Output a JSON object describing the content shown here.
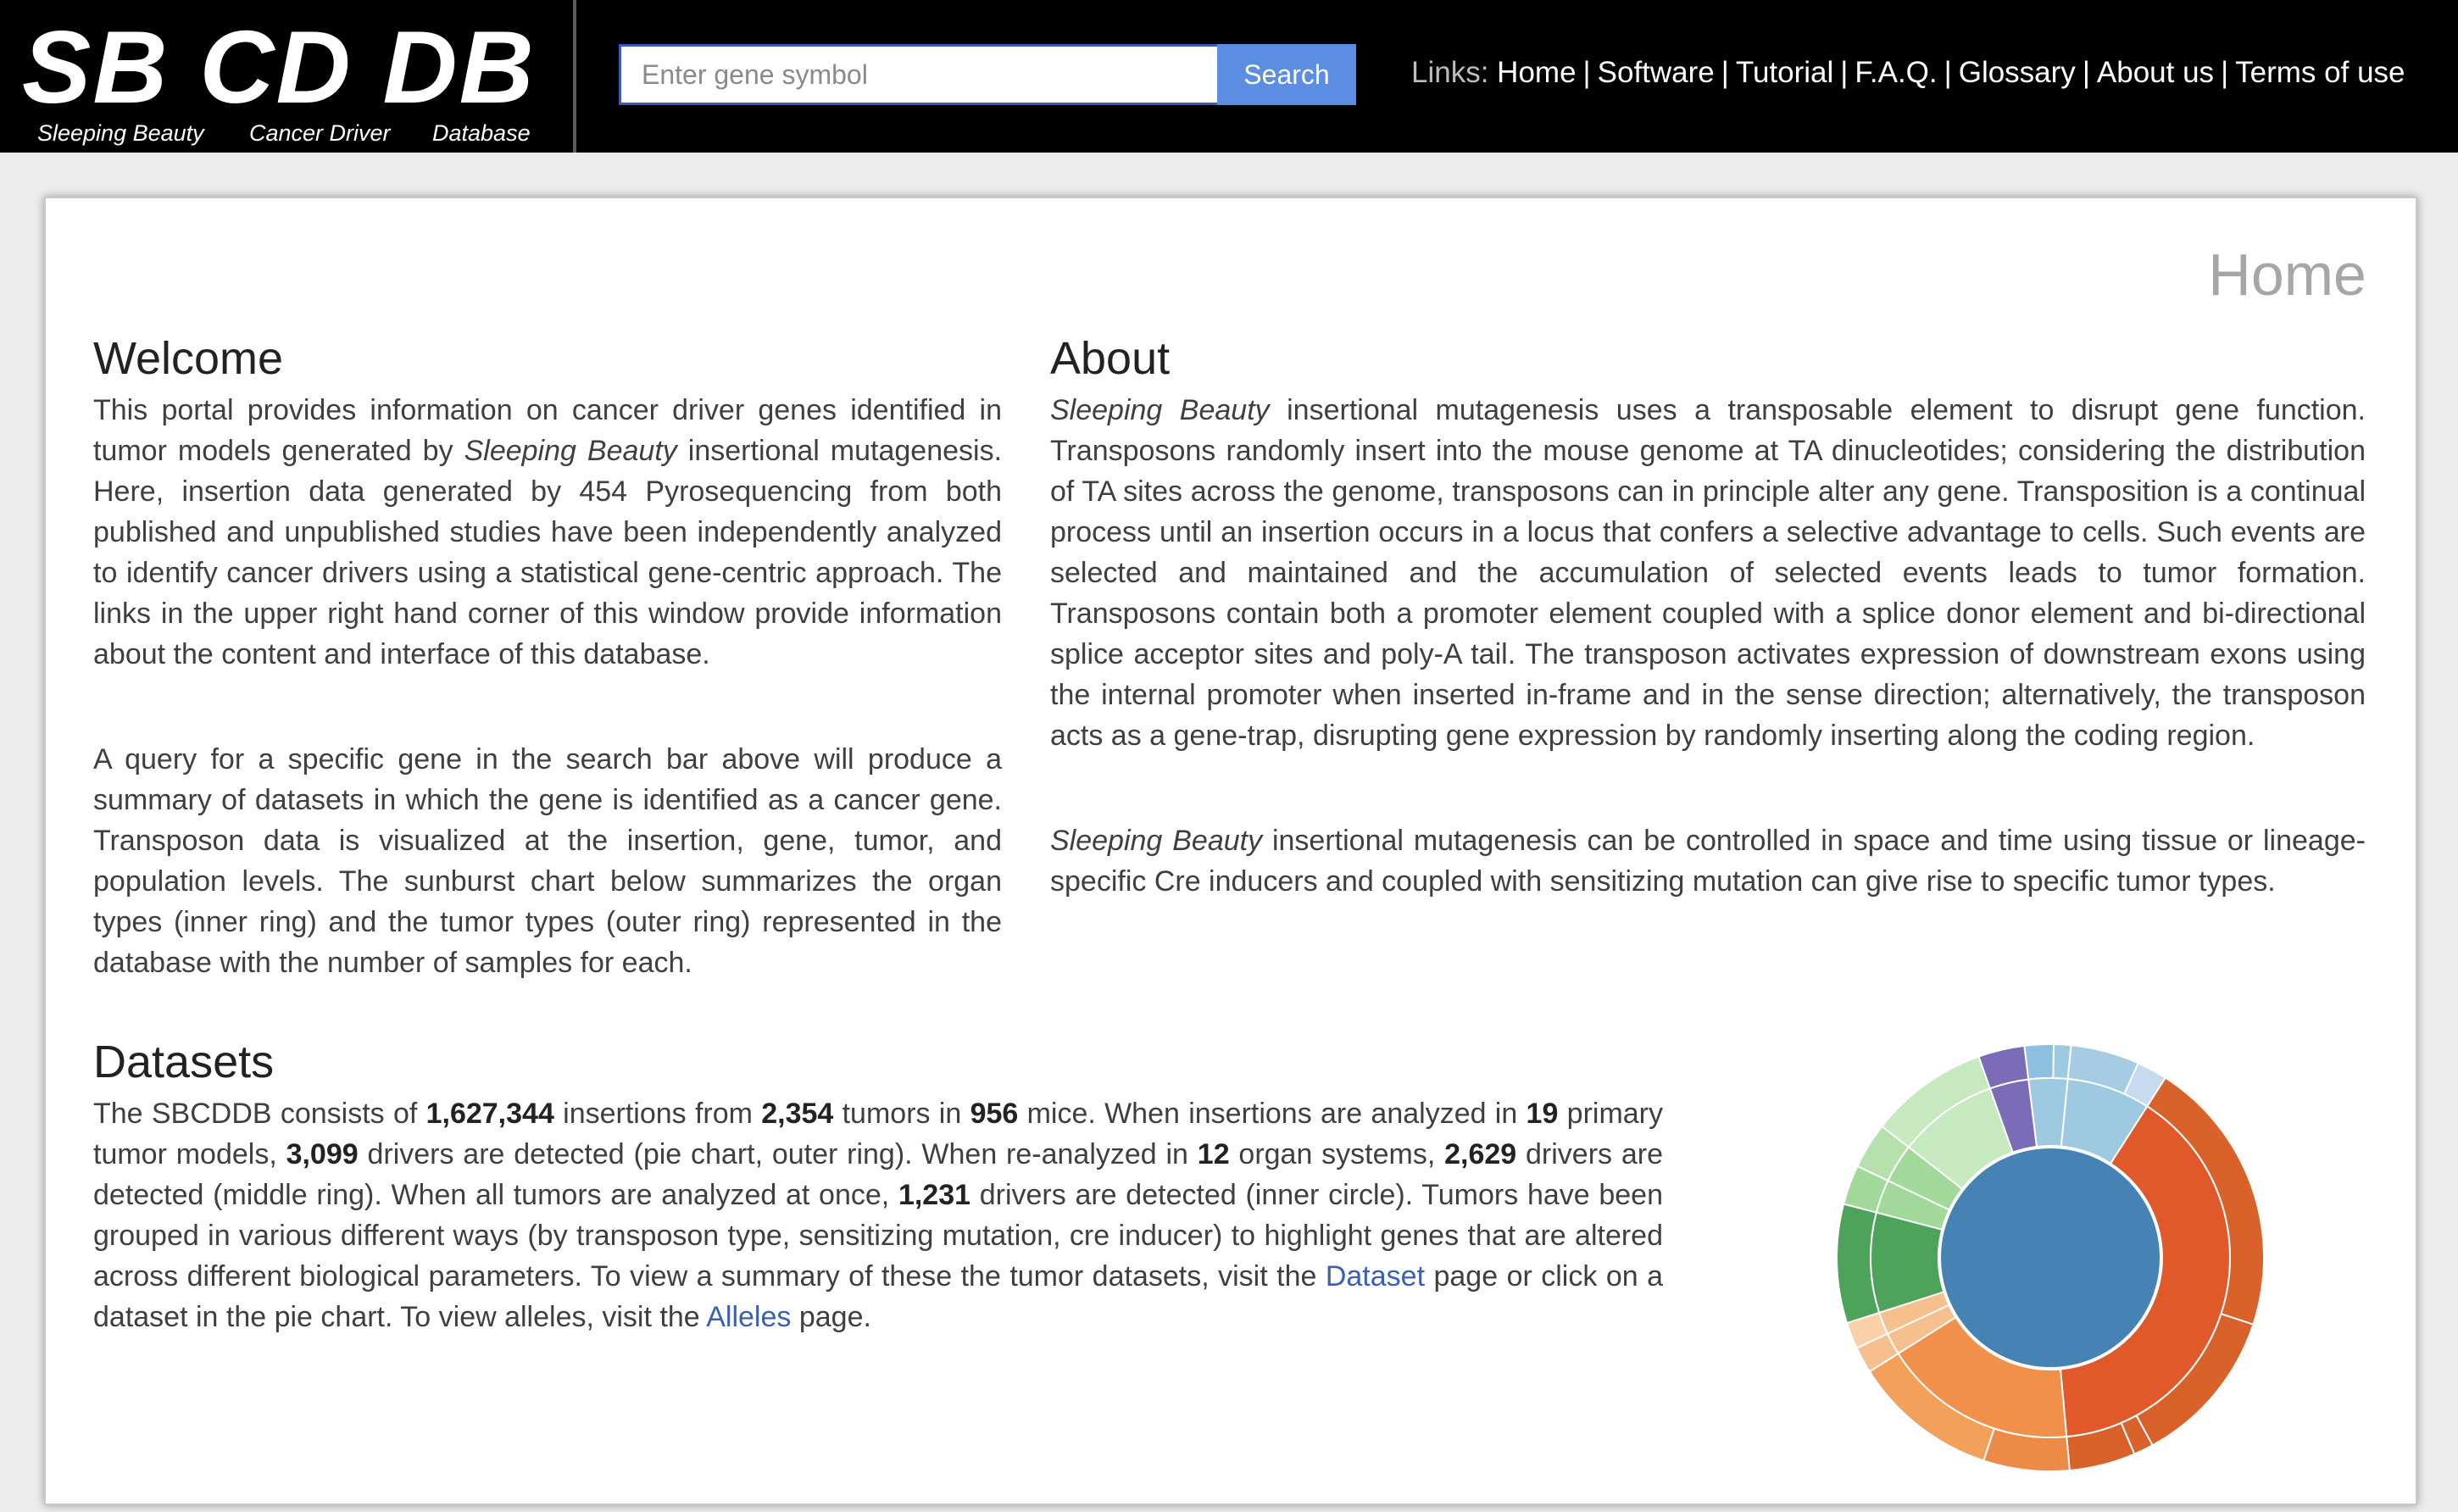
{
  "logo": {
    "title": "SB CD DB",
    "subtitles": [
      "Sleeping Beauty",
      "Cancer Driver",
      "Database"
    ]
  },
  "search": {
    "placeholder": "Enter gene symbol",
    "button_label": "Search"
  },
  "nav": {
    "prefix": "Links:",
    "items": [
      "Home",
      "Software",
      "Tutorial",
      "F.A.Q.",
      "Glossary",
      "About us",
      "Terms of use"
    ]
  },
  "page": {
    "heading": "Home"
  },
  "welcome": {
    "title": "Welcome",
    "p1": {
      "a": "This portal provides information on cancer driver genes identified in tumor models generated by ",
      "em": "Sleeping Beauty",
      "b": " insertional mutagenesis. Here, insertion data generated by 454 Pyrosequencing from both published and unpublished studies have been independently analyzed to identify cancer drivers using a statistical gene-centric approach. The links in the upper right hand corner of this window provide information about the content and interface of this database."
    },
    "p2": "A query for a specific gene in the search bar above will produce a summary of datasets in which the gene is identified as a cancer gene. Transposon data is visualized at the insertion, gene, tumor, and population levels. The sunburst chart below summarizes the organ types (inner ring) and the tumor types (outer ring) represented in the database with the number of samples for each."
  },
  "about": {
    "title": "About",
    "p1": {
      "em": "Sleeping Beauty",
      "rest": " insertional mutagenesis uses a transposable element to disrupt gene function. Transposons randomly insert into the mouse genome at TA dinucleotides; considering the distribution of TA sites across the genome, transposons can in principle alter any gene. Transposition is a continual process until an insertion occurs in a locus that confers a selective advantage to cells. Such events are selected and maintained and the accumulation of selected events leads to tumor formation. Transposons contain both a promoter element coupled with a splice donor element and bi-directional splice acceptor sites and poly-A tail. The transposon activates expression of downstream exons using the internal promoter when inserted in-frame and in the sense direction; alternatively, the transposon acts as a gene-trap, disrupting gene expression by randomly inserting along the coding region."
    },
    "p2": {
      "em": "Sleeping Beauty",
      "rest": " insertional mutagenesis can be controlled in space and time using tissue or lineage-specific Cre inducers and coupled with sensitizing mutation can give rise to specific tumor types."
    }
  },
  "datasets": {
    "title": "Datasets",
    "t1": "The SBCDDB consists of ",
    "insertions": "1,627,344",
    "t2": " insertions from ",
    "tumors": "2,354",
    "t3": " tumors in ",
    "mice": "956",
    "t4": " mice. When insertions are analyzed in ",
    "models": "19",
    "t5": " primary tumor models, ",
    "drivers_models": "3,099",
    "t6": " drivers are detected (pie chart, outer ring). When re-analyzed in ",
    "organs": "12",
    "t7": " organ systems, ",
    "drivers_organs": "2,629",
    "t8": " drivers are detected (middle ring). When all tumors are analyzed at once, ",
    "drivers_all": "1,231",
    "t9": " drivers are detected (inner circle). Tumors have been grouped in various different ways (by transposon type, sensitizing mutation, cre inducer) to highlight genes that are altered across different biological parameters. To view a summary of these the tumor datasets, visit the ",
    "dataset_link": "Dataset",
    "t10": " page or click on a dataset in the pie chart. To view alleles, visit the ",
    "alleles_link": "Alleles",
    "t11": " page."
  },
  "chart_data": {
    "type": "sunburst",
    "center": {
      "color": "#4682b4"
    },
    "middle": [
      {
        "value": 0.035,
        "color": "#9ecae1"
      },
      {
        "value": 0.075,
        "color": "#9ecae1"
      },
      {
        "value": 0.395,
        "color": "#e1582b"
      },
      {
        "value": 0.175,
        "color": "#f0904a"
      },
      {
        "value": 0.02,
        "color": "#f6c08e"
      },
      {
        "value": 0.02,
        "color": "#f6c08e"
      },
      {
        "value": 0.09,
        "color": "#4ea35b"
      },
      {
        "value": 0.03,
        "color": "#a1d99b"
      },
      {
        "value": 0.035,
        "color": "#a1d99b"
      },
      {
        "value": 0.09,
        "color": "#c7e9c0"
      },
      {
        "value": 0.035,
        "color": "#7b6cb8"
      }
    ],
    "outer": [
      {
        "value": 0.022,
        "color": "#8dbfe0"
      },
      {
        "value": 0.013,
        "color": "#9ecae1"
      },
      {
        "value": 0.052,
        "color": "#a6cce3"
      },
      {
        "value": 0.023,
        "color": "#c6dbef"
      },
      {
        "value": 0.21,
        "color": "#d9622b"
      },
      {
        "value": 0.12,
        "color": "#d9622b"
      },
      {
        "value": 0.015,
        "color": "#d9622b"
      },
      {
        "value": 0.05,
        "color": "#d9622b"
      },
      {
        "value": 0.065,
        "color": "#ee8a47"
      },
      {
        "value": 0.11,
        "color": "#f3a05a"
      },
      {
        "value": 0.02,
        "color": "#f6c08e"
      },
      {
        "value": 0.02,
        "color": "#f9d0a8"
      },
      {
        "value": 0.09,
        "color": "#4ea35b"
      },
      {
        "value": 0.03,
        "color": "#a1d99b"
      },
      {
        "value": 0.035,
        "color": "#b6e1ad"
      },
      {
        "value": 0.09,
        "color": "#c7e9c0"
      },
      {
        "value": 0.035,
        "color": "#7b6cb8"
      }
    ]
  }
}
